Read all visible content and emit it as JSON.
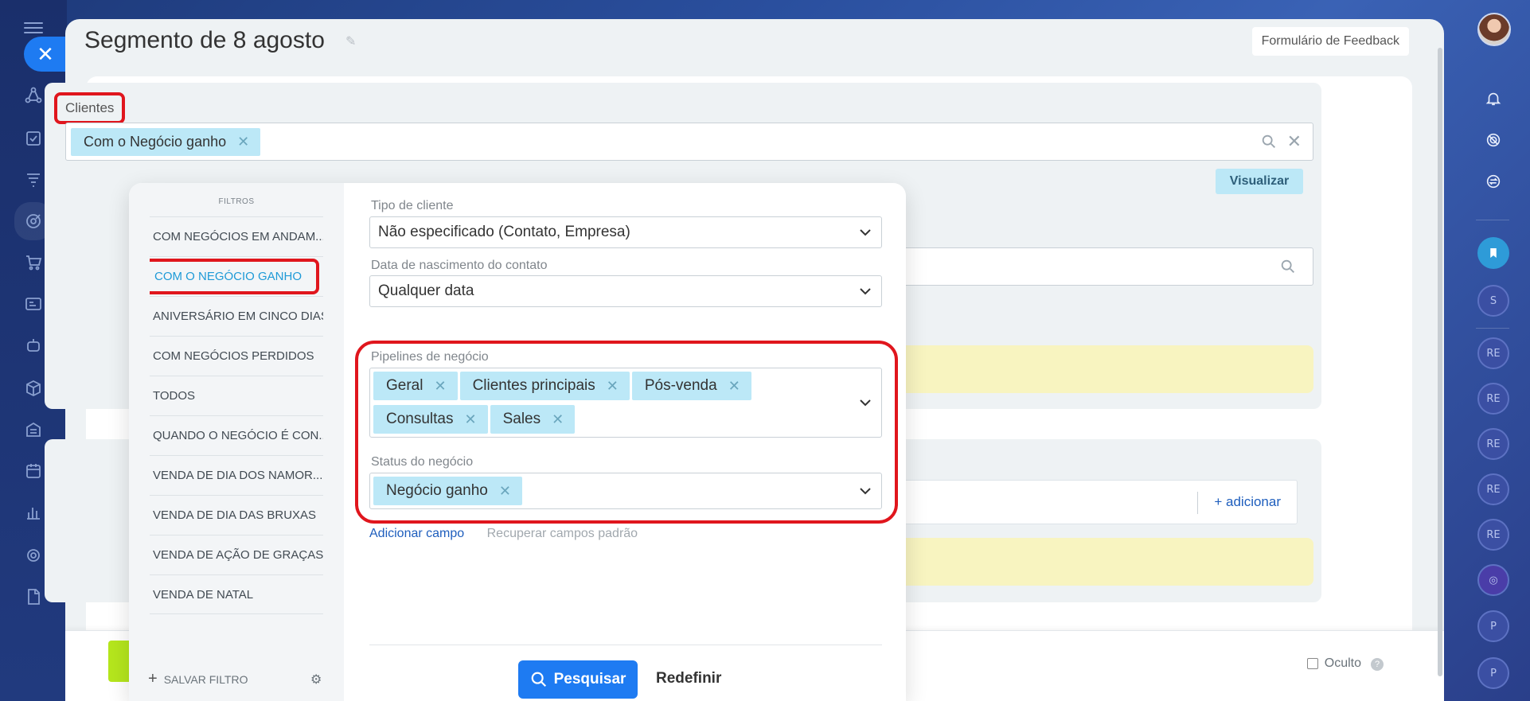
{
  "page": {
    "title": "Segmento de 8 agosto",
    "feedback_button": "Formulário de Feedback"
  },
  "section": {
    "label": "Clientes",
    "active_filter_tag": "Com o Negócio ganho",
    "visualizar_button": "Visualizar",
    "adicionar_link": "+ adicionar"
  },
  "filters_panel": {
    "heading": "FILTROS",
    "items": [
      "COM NEGÓCIOS EM ANDAM...",
      "COM O NEGÓCIO GANHO",
      "ANIVERSÁRIO EM CINCO DIAS",
      "COM NEGÓCIOS PERDIDOS",
      "TODOS",
      "QUANDO O NEGÓCIO É CON...",
      "VENDA DE DIA DOS NAMOR...",
      "VENDA DE DIA DAS BRUXAS",
      "VENDA DE AÇÃO DE GRAÇAS",
      "VENDA DE NATAL"
    ],
    "active_index": 1,
    "save_filter": "SALVAR FILTRO"
  },
  "form": {
    "tipo_cliente_label": "Tipo de cliente",
    "tipo_cliente_value": "Não especificado (Contato, Empresa)",
    "data_nasc_label": "Data de nascimento do contato",
    "data_nasc_value": "Qualquer data",
    "pipelines_label": "Pipelines de negócio",
    "pipelines": [
      "Geral",
      "Clientes principais",
      "Pós-venda",
      "Consultas",
      "Sales"
    ],
    "status_label": "Status do negócio",
    "status_tags": [
      "Negócio ganho"
    ],
    "add_field_link": "Adicionar campo",
    "restore_link": "Recuperar campos padrão",
    "search_button": "Pesquisar",
    "reset_button": "Redefinir"
  },
  "footer": {
    "oculto_label": "Oculto",
    "help": "?"
  },
  "right_rail": {
    "badges": [
      "S",
      "RE",
      "RE",
      "RE",
      "RE",
      "RE",
      "P",
      "P"
    ]
  },
  "colors": {
    "accent_blue": "#1e7bf2",
    "tag_bg": "#bce8f7",
    "highlight_red": "#e0161d",
    "warning_yellow": "#f8f4c0",
    "green_button": "#b5e61d"
  }
}
